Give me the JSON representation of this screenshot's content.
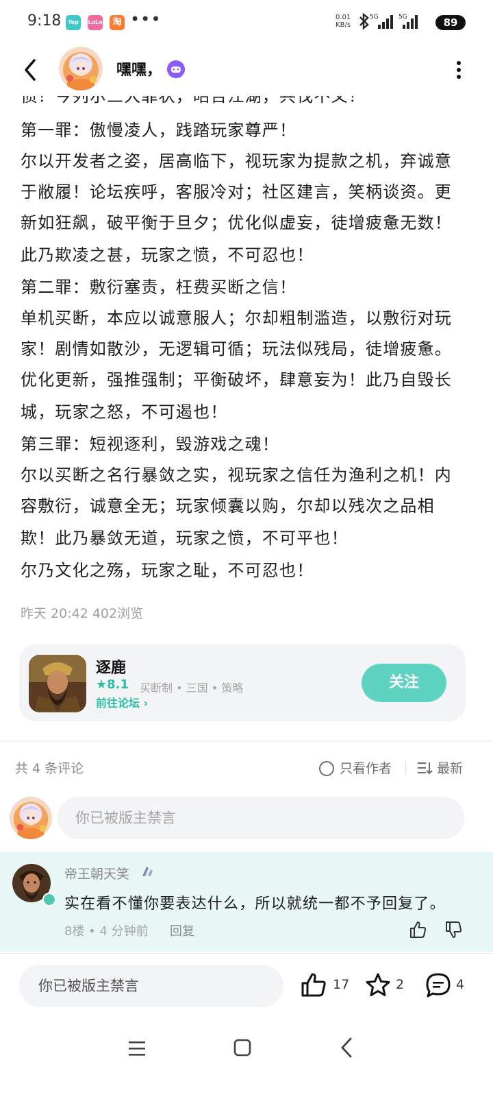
{
  "status_bar": {
    "time": "9:18",
    "apps": [
      "Top",
      "LoLo",
      "淘"
    ],
    "more": "•••",
    "net_speed": "0.01",
    "net_unit": "KB/s",
    "signal1": "5G",
    "signal2": "5G",
    "battery": "89"
  },
  "header": {
    "username": "嘿嘿，"
  },
  "article": {
    "cut_line": "愤！今列尔三大罪状，昭告江湖，共伐不义！",
    "lines": [
      "第一罪：傲慢凌人，践踏玩家尊严！",
      "尔以开发者之姿，居高临下，视玩家为提款之机，弃诚意",
      "于敝履！论坛疾呼，客服冷对；社区建言，笑柄谈资。更",
      "新如狂飙，破平衡于旦夕；优化似虚妄，徒增疲惫无数！",
      "此乃欺凌之甚，玩家之愤，不可忍也！",
      "第二罪：敷衍塞责，枉费买断之信！",
      "单机买断，本应以诚意服人；尔却粗制滥造，以敷衍对玩",
      "家！剧情如散沙，无逻辑可循；玩法似残局，徒增疲惫。",
      "优化更新，强推强制；平衡破坏，肆意妄为！此乃自毁长",
      "城，玩家之怒，不可遏也！",
      "第三罪：短视逐利，毁游戏之魂！",
      "尔以买断之名行暴敛之实，视玩家之信任为渔利之机！内",
      "容敷衍，诚意全无；玩家倾囊以购，尔却以残次之品相",
      "欺！此乃暴敛无道，玩家之愤，不可平也！",
      "尔乃文化之殇，玩家之耻，不可忍也！"
    ],
    "meta": "昨天 20:42  402浏览"
  },
  "game_card": {
    "name": "逐鹿",
    "rating": "8.1",
    "tags": "买断制  •  三国  •  策略",
    "forum_link": "前往论坛",
    "follow_label": "关注"
  },
  "comments_header": {
    "count": "共 4 条评论",
    "author_only": "只看作者",
    "sort": "最新"
  },
  "comment_input": {
    "placeholder": "你已被版主禁言"
  },
  "comment": {
    "user": "帝王朝天笑",
    "text": "实在看不懂你要表达什么，所以就统一都不予回复了。",
    "meta": "8楼  •  4 分钟前",
    "reply": "回复"
  },
  "bottom_bar": {
    "placeholder": "你已被版主禁言",
    "likes": "17",
    "stars": "2",
    "comments": "4"
  },
  "colors": {
    "accent": "#5fd3c2",
    "accent_text": "#2dbda6",
    "comment_bg": "#e8f7f5",
    "badge": "#8b5cf6"
  }
}
